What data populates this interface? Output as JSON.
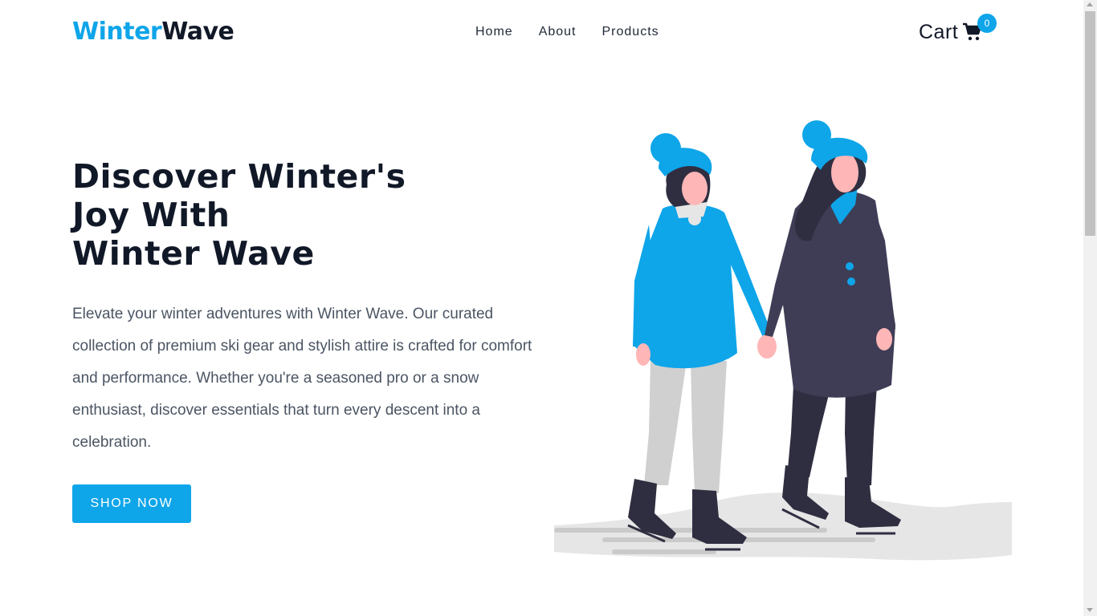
{
  "brand": {
    "part1": "Winter",
    "part2": "Wave"
  },
  "nav": {
    "items": [
      {
        "label": "Home"
      },
      {
        "label": "About"
      },
      {
        "label": "Products"
      }
    ]
  },
  "cart": {
    "label": "Cart",
    "count": "0",
    "icon": "shopping-cart-icon"
  },
  "hero": {
    "title_line1": "Discover Winter's",
    "title_line2": "Joy With",
    "title_line3": "Winter Wave",
    "description": "Elevate your winter adventures with Winter Wave. Our curated collection of premium ski gear and stylish attire is crafted for comfort and performance. Whether you're a seasoned pro or a snow enthusiast, discover essentials that turn every descent into a celebration.",
    "cta_label": "SHOP NOW"
  },
  "colors": {
    "accent": "#0ea5e9",
    "dark": "#111827",
    "coat": "#3f3d56",
    "skin": "#ffb6b6",
    "snow": "#e6e6e6"
  }
}
